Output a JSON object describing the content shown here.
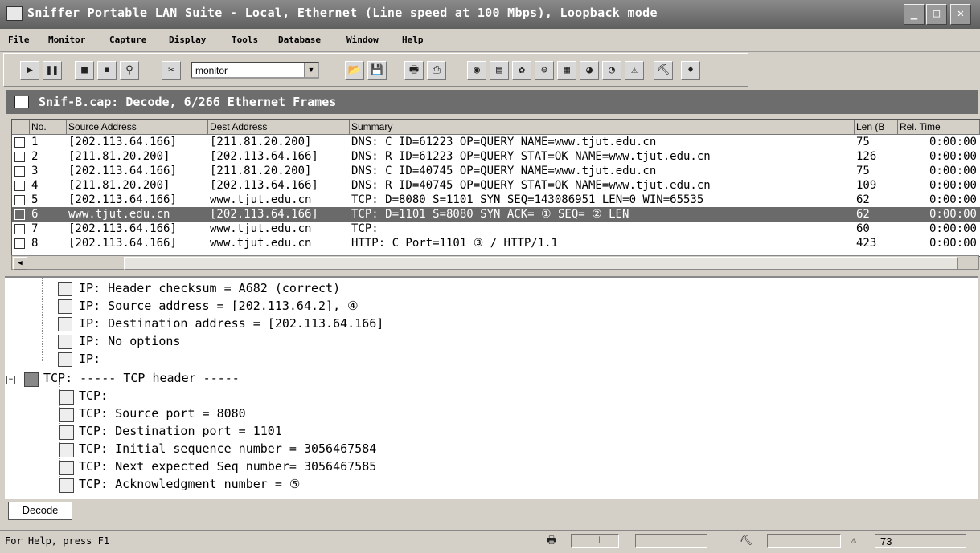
{
  "window": {
    "title": "Sniffer Portable LAN Suite - Local, Ethernet (Line speed at 100 Mbps), Loopback mode"
  },
  "menu": [
    "File",
    "Monitor",
    "Capture",
    "Display",
    "Tools",
    "Database",
    "Window",
    "Help"
  ],
  "toolbar": {
    "monitor_value": "monitor"
  },
  "doc_title": "Snif-B.cap: Decode, 6/266 Ethernet Frames",
  "columns": [
    "No.",
    "Source Address",
    "Dest Address",
    "Summary",
    "Len (B",
    "Rel. Time"
  ],
  "frames": [
    {
      "no": "1",
      "src": "[202.113.64.166]",
      "dst": "[211.81.20.200]",
      "summary": "DNS: C ID=61223 OP=QUERY NAME=www.tjut.edu.cn",
      "len": "75",
      "time": "0:00:00"
    },
    {
      "no": "2",
      "src": "[211.81.20.200]",
      "dst": "[202.113.64.166]",
      "summary": "DNS: R ID=61223 OP=QUERY STAT=OK NAME=www.tjut.edu.cn",
      "len": "126",
      "time": "0:00:00"
    },
    {
      "no": "3",
      "src": "[202.113.64.166]",
      "dst": "[211.81.20.200]",
      "summary": "DNS: C ID=40745 OP=QUERY NAME=www.tjut.edu.cn",
      "len": "75",
      "time": "0:00:00"
    },
    {
      "no": "4",
      "src": "[211.81.20.200]",
      "dst": "[202.113.64.166]",
      "summary": "DNS: R ID=40745 OP=QUERY STAT=OK NAME=www.tjut.edu.cn",
      "len": "109",
      "time": "0:00:00"
    },
    {
      "no": "5",
      "src": "[202.113.64.166]",
      "dst": "www.tjut.edu.cn",
      "summary": "TCP: D=8080 S=1101 SYN SEQ=143086951 LEN=0 WIN=65535",
      "len": "62",
      "time": "0:00:00"
    },
    {
      "no": "6",
      "src": "www.tjut.edu.cn",
      "dst": "[202.113.64.166]",
      "summary": "TCP: D=1101 S=8080 SYN ACK=      ①      SEQ=    ②      LEN",
      "len": "62",
      "time": "0:00:00",
      "selected": true
    },
    {
      "no": "7",
      "src": "[202.113.64.166]",
      "dst": "www.tjut.edu.cn",
      "summary": "TCP:",
      "len": "60",
      "time": "0:00:00"
    },
    {
      "no": "8",
      "src": "[202.113.64.166]",
      "dst": "www.tjut.edu.cn",
      "summary": "HTTP: C Port=1101   ③  / HTTP/1.1",
      "len": "423",
      "time": "0:00:00"
    }
  ],
  "decode": {
    "ip_lines": [
      "IP: Header checksum = A682 (correct)",
      "IP: Source address      = [202.113.64.2],  ④",
      "IP: Destination address = [202.113.64.166]",
      "IP: No options",
      "IP:"
    ],
    "tcp_header": "TCP: ----- TCP header -----",
    "tcp_lines": [
      "TCP:",
      "TCP: Source port             =  8080",
      "TCP: Destination port        =  1101",
      "TCP: Initial sequence number = 3056467584",
      "TCP: Next expected Seq number= 3056467585",
      "TCP: Acknowledgment number   =    ⑤"
    ]
  },
  "tabs": [
    "Decode"
  ],
  "status": {
    "help": "For Help, press F1",
    "count": "73"
  }
}
